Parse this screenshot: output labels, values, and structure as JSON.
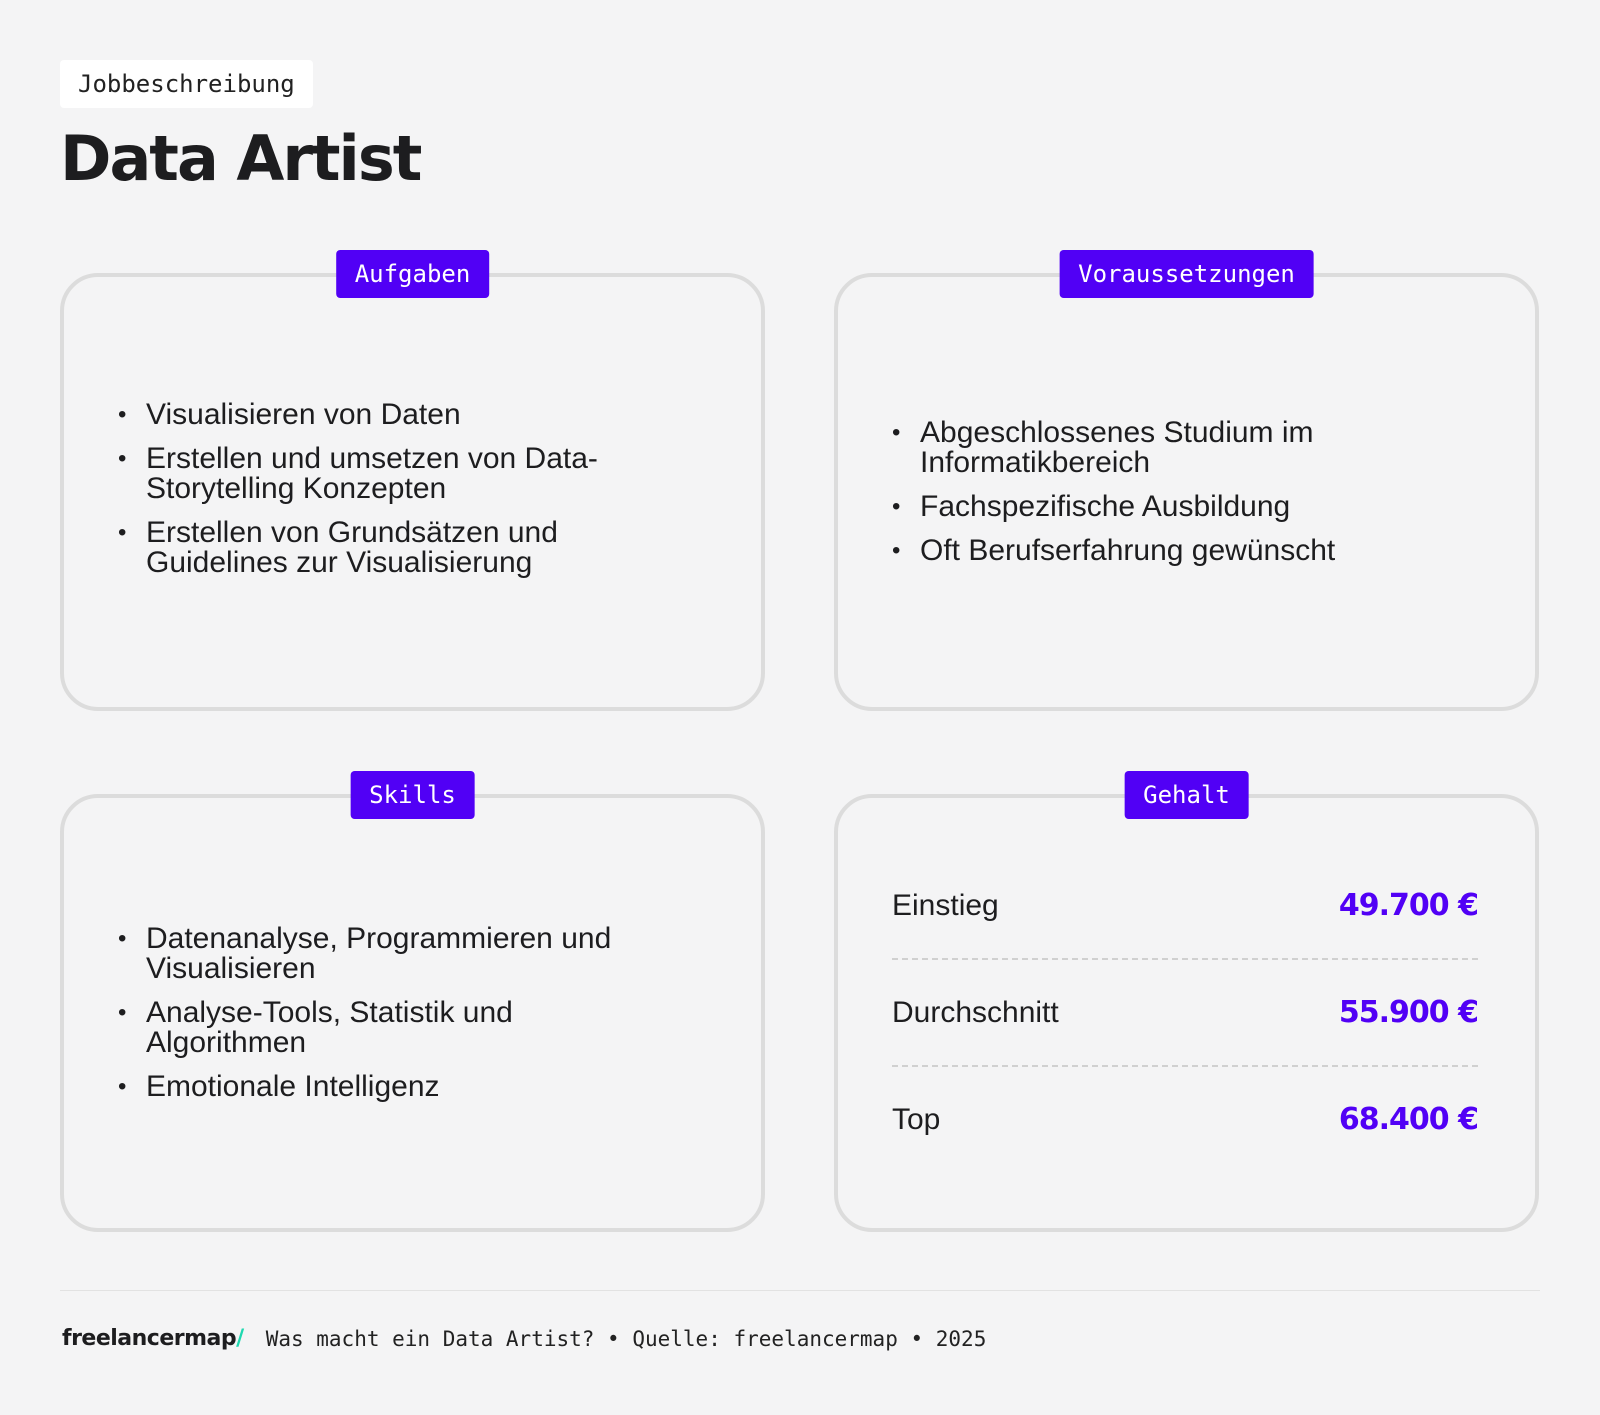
{
  "header": {
    "eyebrow": "Jobbeschreibung",
    "title": "Data Artist"
  },
  "cards": {
    "aufgaben": {
      "tag": "Aufgaben",
      "items": [
        "Visualisieren von Daten",
        "Erstellen und umsetzen von Data-Storytelling Konzepten",
        "Erstellen von Grundsätzen und Guidelines zur Visualisierung"
      ]
    },
    "voraussetzungen": {
      "tag": "Voraussetzungen",
      "items": [
        "Abgeschlossenes Studium im Informatikbereich",
        "Fachspezifische Ausbildung",
        "Oft Berufserfahrung gewünscht"
      ]
    },
    "skills": {
      "tag": "Skills",
      "items": [
        "Datenanalyse, Programmieren und Visualisieren",
        "Analyse-Tools, Statistik und Algorithmen",
        "Emotionale Intelligenz"
      ]
    },
    "gehalt": {
      "tag": "Gehalt",
      "rows": [
        {
          "label": "Einstieg",
          "value": "49.700 €"
        },
        {
          "label": "Durchschnitt",
          "value": "55.900 €"
        },
        {
          "label": "Top",
          "value": "68.400 €"
        }
      ]
    }
  },
  "footer": {
    "logo_text": "freelancermap",
    "logo_slash": "/",
    "caption": "Was macht ein Data Artist? • Quelle: freelancermap • 2025"
  },
  "colors": {
    "accent": "#5100f5",
    "logo_accent": "#1fd8b0",
    "background": "#f4f4f5"
  }
}
